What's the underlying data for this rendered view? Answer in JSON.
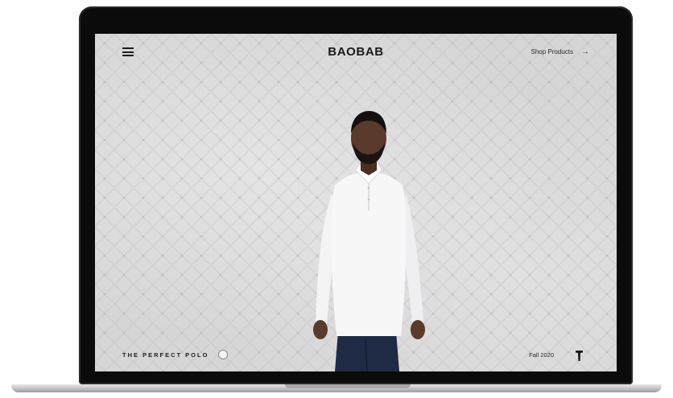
{
  "header": {
    "brand": "BAOBAB",
    "shop_link": "Shop Products",
    "icons": {
      "menu": "hamburger-menu-icon",
      "arrow": "arrow-right-icon"
    }
  },
  "hero": {
    "tagline": "THE PERFECT POLO",
    "season": "Fall 2020",
    "logo_mark": "baobab-tree-logo"
  },
  "colors": {
    "screen_background": "#d6d6d7",
    "text": "#1a1a1c",
    "bezel": "#0b0b0c"
  }
}
